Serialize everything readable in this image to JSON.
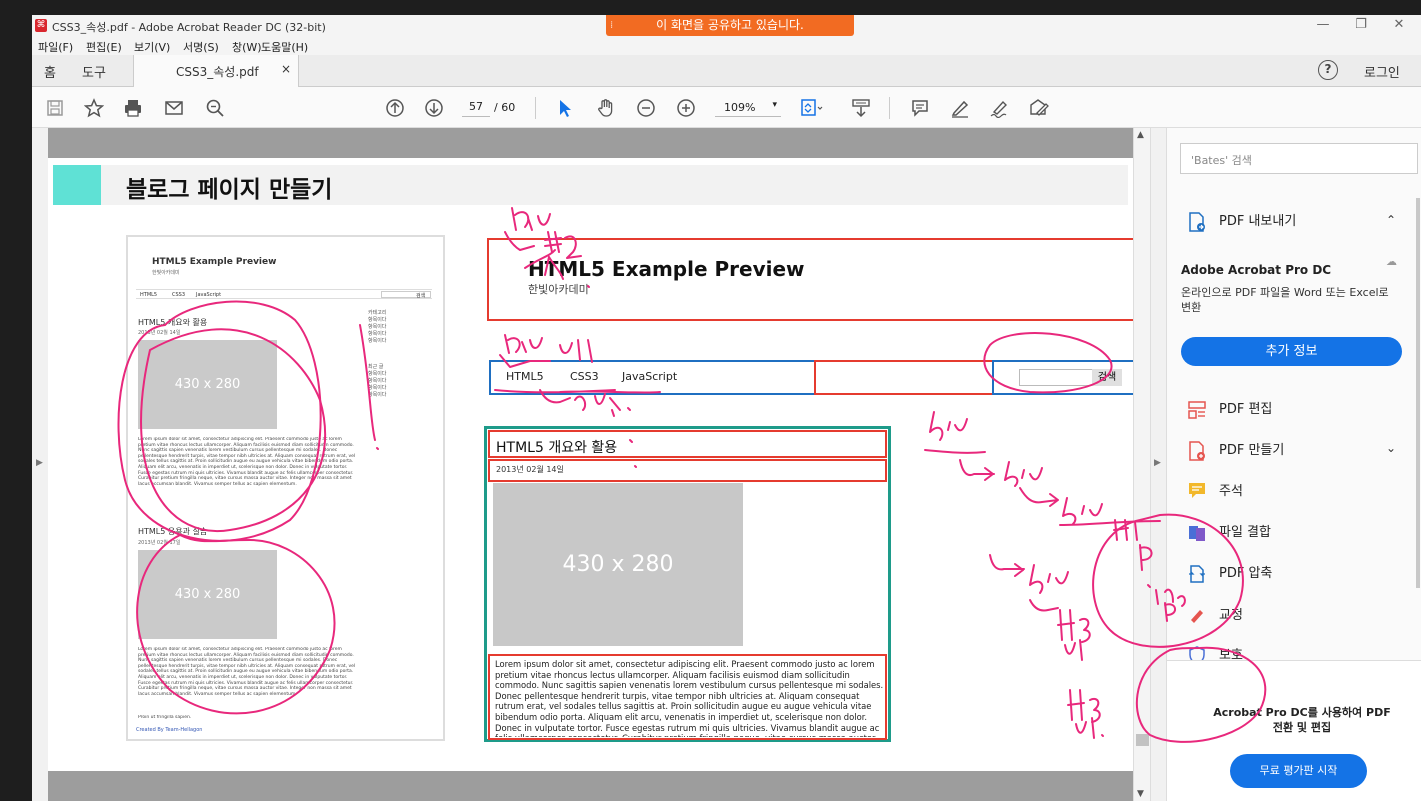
{
  "window": {
    "title": "CSS3_속성.pdf - Adobe Acrobat Reader DC (32-bit)",
    "share_banner": "이 화면을 공유하고 있습니다.",
    "minimize": "—",
    "restore": "❐",
    "close": "✕"
  },
  "menu": [
    "파일(F)",
    "편집(E)",
    "보기(V)",
    "서명(S)",
    "창(W)",
    "도움말(H)"
  ],
  "tabs": {
    "home": "홈",
    "tools": "도구",
    "document": "CSS3_속성.pdf",
    "close_glyph": "×",
    "help": "?",
    "login": "로그인"
  },
  "toolbar": {
    "current_page": "57",
    "page_total": "/ 60",
    "zoom": "109%",
    "zoom_arrow": "▾"
  },
  "slide": {
    "title": "블로그 페이지 만들기"
  },
  "thumbnail": {
    "title": "HTML5 Example Preview",
    "subtitle": "한빛아카데미",
    "nav": [
      "HTML5",
      "CSS3",
      "JavaScript"
    ],
    "search_btn": "검색",
    "article1_title": "HTML5 개요와 활용",
    "article1_date": "2013년 02월 14일",
    "image_label": "430 x 280",
    "article2_title": "HTML5 응용과 실습",
    "article2_date": "2013년 02월 17일",
    "lorem": "Lorem ipsum dolor sit amet, consectetur adipiscing elit. Praesent commodo justo ac lorem pretium vitae rhoncus lectus ullamcorper. Aliquam facilisis euismod diam sollicitudin commodo. Nunc sagittis sapien venenatis lorem vestibulum cursus pellentesque mi sodales. Donec pellentesque hendrerit turpis, vitae tempor nibh ultricies at. Aliquam consequat rutrum erat, vel sodales tellus sagittis at. Proin sollicitudin augue eu augue vehicula vitae bibendum odio porta. Aliquam elit arcu, venenatis in imperdiet ut, scelerisque non dolor. Donec in vulputate tortor. Fusce egestas rutrum mi quis ultricies. Vivamus blandit augue ac felis ullamcorper consectetur. Curabitur pretium fringilla neque, vitae cursus massa auctor vitae. Integer non massa sit amet lacus accumsan blandit. Vivamus semper tellus ac sapien elementum.",
    "proin": "Proin ut fringilla sapien.",
    "side_heading1": "카테고리",
    "side_heading2": "최근 글",
    "side_item": "항목이다",
    "footer": "Created By Team-Hellagon"
  },
  "enlarged": {
    "header_title": "HTML5 Example Preview",
    "header_sub": "한빛아카데미",
    "nav": [
      "HTML5",
      "CSS3",
      "JavaScript"
    ],
    "search_btn": "검색",
    "article_title": "HTML5 개요와 활용",
    "article_date": "2013년 02월 14일",
    "image_label": "430 x 280",
    "article_text": "Lorem ipsum dolor sit amet, consectetur adipiscing elit. Praesent commodo justo ac lorem pretium vitae rhoncus lectus ullamcorper. Aliquam facilisis euismod diam sollicitudin commodo. Nunc sagittis sapien venenatis lorem vestibulum cursus pellentesque mi sodales. Donec pellentesque hendrerit turpis, vitae tempor nibh ultricies at. Aliquam consequat rutrum erat, vel sodales tellus sagittis at. Proin sollicitudin augue eu augue vehicula vitae bibendum odio porta. Aliquam elit arcu, venenatis in imperdiet ut, scelerisque non dolor. Donec in vulputate tortor. Fusce egestas rutrum mi quis ultricies. Vivamus blandit augue ac felis ullamcorper consectetur. Curabitur pretium fringilla neque, vitae cursus massa auctor vitae."
  },
  "right_panel": {
    "search_placeholder": "'Bates' 검색",
    "export_pdf": "PDF 내보내기",
    "promo_title": "Adobe Acrobat Pro DC",
    "promo_desc": "온라인으로 PDF 파일을 Word 또는 Excel로 변환",
    "more_info": "추가 정보",
    "edit_pdf": "PDF 편집",
    "create_pdf": "PDF 만들기",
    "comment": "주석",
    "combine": "파일 결합",
    "compress": "PDF 압축",
    "redact": "교정",
    "protect": "보호",
    "bottom_promo": "Acrobat Pro DC를 사용하여 PDF 전환 및 편집",
    "trial_button": "무료 평가판 시작"
  },
  "annotations": {
    "color": "#e8287c",
    "texts": [
      "div",
      "h1",
      "p",
      "ul",
      "div",
      "div",
      "div",
      "div",
      "div",
      "H1",
      "P",
      "img",
      "P",
      "H3",
      "ul",
      "H3",
      "ul"
    ]
  }
}
